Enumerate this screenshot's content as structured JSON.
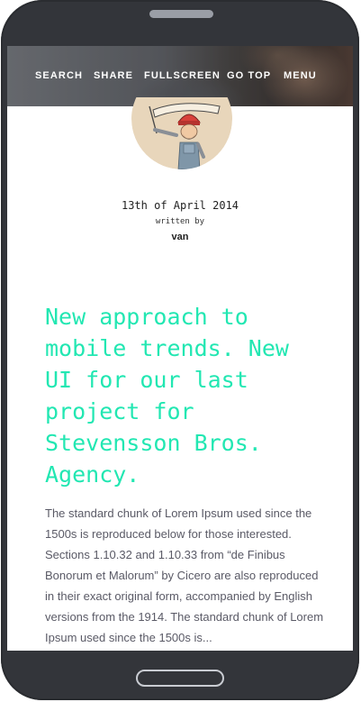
{
  "nav": {
    "items": [
      {
        "label": "SEARCH"
      },
      {
        "label": "SHARE"
      },
      {
        "label": "FULLSCREEN"
      },
      {
        "label": "GO TOP"
      },
      {
        "label": "MENU"
      }
    ]
  },
  "post": {
    "date": "13th of April 2014",
    "written_by": "written by",
    "author": "van",
    "headline": "New approach to mobile trends. New UI for our last project for Stevensson Bros. Agency.",
    "body": "The standard chunk of Lorem Ipsum used since the 1500s is reproduced below for those interested. Sections 1.10.32 and 1.10.33 from “de Finibus Bonorum et Malorum” by Cicero are also reproduced in their exact original form, accompanied by English versions from the 1914. The standard chunk of Lorem Ipsum used since the 1500s is..."
  },
  "colors": {
    "accent": "#22e7b2",
    "phone_body": "#33353a",
    "body_text": "#5a5a66"
  },
  "icons": {
    "avatar": "illustrated-man-with-red-beanie-holding-banner"
  }
}
